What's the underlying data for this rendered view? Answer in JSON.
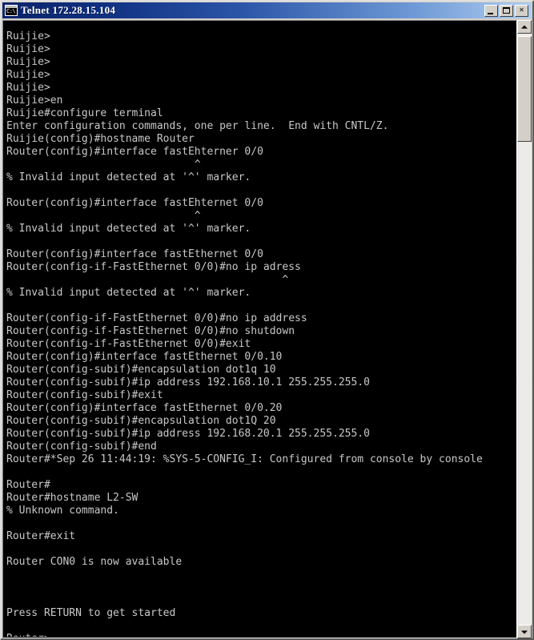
{
  "window": {
    "title": "Telnet  172.28.15.104",
    "app_icon": "console-icon",
    "icon_glyph": "C:\\",
    "accent_title_start": "#0a246a",
    "accent_title_end": "#b0cdf0",
    "face_color": "#d4d0c8",
    "console_bg": "#000000",
    "console_fg": "#c8c8c8"
  },
  "titlebar_buttons": {
    "minimize_label": "_",
    "maximize_label": "□",
    "close_label": "✕"
  },
  "scrollbar": {
    "up_arrow": "scroll-up-arrow",
    "down_arrow": "scroll-down-arrow",
    "thumb": "scroll-thumb"
  },
  "terminal": {
    "host": "172.28.15.104",
    "prompt_initial": "Ruijie>",
    "prompt_final": "Router>",
    "lines": [
      "Ruijie>",
      "Ruijie>",
      "Ruijie>",
      "Ruijie>",
      "Ruijie>",
      "Ruijie>en",
      "Ruijie#configure terminal",
      "Enter configuration commands, one per line.  End with CNTL/Z.",
      "Ruijie(config)#hostname Router",
      "Router(config)#interface fastEhterner 0/0",
      "                              ^",
      "% Invalid input detected at '^' marker.",
      "",
      "Router(config)#interface fastEhternet 0/0",
      "                              ^",
      "% Invalid input detected at '^' marker.",
      "",
      "Router(config)#interface fastEthernet 0/0",
      "Router(config-if-FastEthernet 0/0)#no ip adress",
      "                                            ^",
      "% Invalid input detected at '^' marker.",
      "",
      "Router(config-if-FastEthernet 0/0)#no ip address",
      "Router(config-if-FastEthernet 0/0)#no shutdown",
      "Router(config-if-FastEthernet 0/0)#exit",
      "Router(config)#interface fastEthernet 0/0.10",
      "Router(config-subif)#encapsulation dot1q 10",
      "Router(config-subif)#ip address 192.168.10.1 255.255.255.0",
      "Router(config-subif)#exit",
      "Router(config)#interface fastEthernet 0/0.20",
      "Router(config-subif)#encapsulation dot1Q 20",
      "Router(config-subif)#ip address 192.168.20.1 255.255.255.0",
      "Router(config-subif)#end",
      "Router#*Sep 26 11:44:19: %SYS-5-CONFIG_I: Configured from console by console",
      "",
      "Router#",
      "Router#hostname L2-SW",
      "% Unknown command.",
      "",
      "Router#exit",
      "",
      "Router CON0 is now available",
      "",
      "",
      "",
      "Press RETURN to get started",
      "",
      "Router>"
    ]
  }
}
